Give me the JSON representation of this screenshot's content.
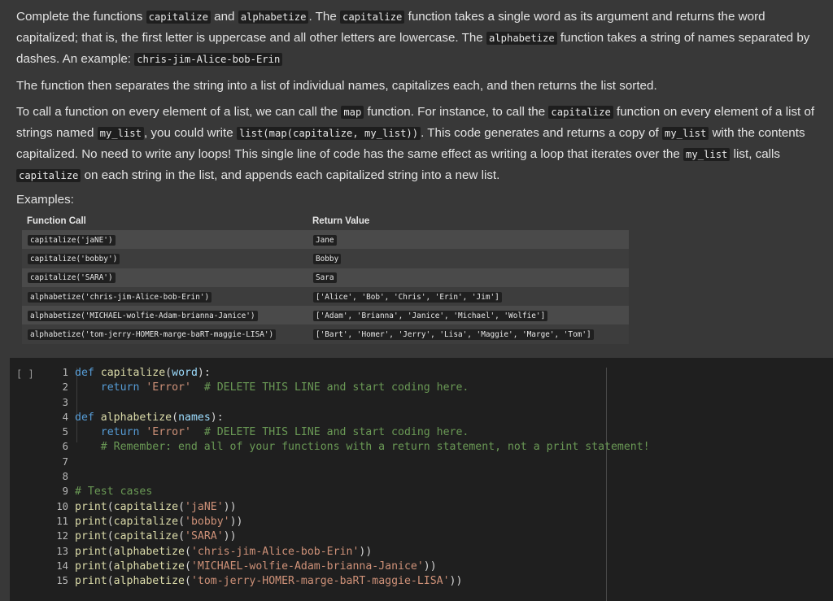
{
  "markdown": {
    "p1": {
      "t1": "Complete the functions ",
      "c1": "capitalize",
      "t2": " and ",
      "c2": "alphabetize",
      "t3": ". The ",
      "c3": "capitalize",
      "t4": " function takes a single word as its argument and returns the word capitalized; that is, the first letter is uppercase and all other letters are lowercase. The ",
      "c4": "alphabetize",
      "t5": " function takes a string of names separated by dashes. An example: ",
      "c5": "chris-jim-Alice-bob-Erin"
    },
    "p2": "The function then separates the string into a list of individual names, capitalizes each, and then returns the list sorted.",
    "p3": {
      "t1": "To call a function on every element of a list, we can call the ",
      "c1": "map",
      "t2": " function. For instance, to call the ",
      "c2": "capitalize",
      "t3": " function on every element of a list of strings named ",
      "c3": "my_list",
      "t4": ", you could write ",
      "c4": "list(map(capitalize, my_list))",
      "t5": ". This code generates and returns a copy of ",
      "c5": "my_list",
      "t6": " with the contents capitalized. No need to write any loops! This single line of code has the same effect as writing a loop that iterates over the ",
      "c6": "my_list",
      "t7": " list, calls ",
      "c7": "capitalize",
      "t8": " on each string in the list, and appends each capitalized string into a new list."
    },
    "examples_label": "Examples:",
    "table": {
      "headers": [
        "Function Call",
        "Return Value"
      ],
      "rows": [
        [
          "capitalize('jaNE')",
          "Jane"
        ],
        [
          "capitalize('bobby')",
          "Bobby"
        ],
        [
          "capitalize('SARA')",
          "Sara"
        ],
        [
          "alphabetize('chris-jim-Alice-bob-Erin')",
          "['Alice', 'Bob', 'Chris', 'Erin', 'Jim']"
        ],
        [
          "alphabetize('MICHAEL-wolfie-Adam-brianna-Janice')",
          "['Adam', 'Brianna', 'Janice', 'Michael', 'Wolfie']"
        ],
        [
          "alphabetize('tom-jerry-HOMER-marge-baRT-maggie-LISA')",
          "['Bart', 'Homer', 'Jerry', 'Lisa', 'Maggie', 'Marge', 'Tom']"
        ]
      ]
    }
  },
  "code_cell": {
    "run_indicator": "[ ]",
    "lines": [
      {
        "n": "1",
        "tokens": [
          [
            "kw",
            "def "
          ],
          [
            "fn",
            "capitalize"
          ],
          [
            "punc",
            "("
          ],
          [
            "par",
            "word"
          ],
          [
            "punc",
            "):"
          ]
        ]
      },
      {
        "n": "2",
        "tokens": [
          [
            "pr",
            "    "
          ],
          [
            "kw",
            "return "
          ],
          [
            "str",
            "'Error'"
          ],
          [
            "pr",
            "  "
          ],
          [
            "cm",
            "# DELETE THIS LINE and start coding here."
          ]
        ]
      },
      {
        "n": "3",
        "tokens": []
      },
      {
        "n": "4",
        "tokens": [
          [
            "kw",
            "def "
          ],
          [
            "fn",
            "alphabetize"
          ],
          [
            "punc",
            "("
          ],
          [
            "par",
            "names"
          ],
          [
            "punc",
            "):"
          ]
        ]
      },
      {
        "n": "5",
        "tokens": [
          [
            "pr",
            "    "
          ],
          [
            "kw",
            "return "
          ],
          [
            "str",
            "'Error'"
          ],
          [
            "pr",
            "  "
          ],
          [
            "cm",
            "# DELETE THIS LINE and start coding here."
          ]
        ]
      },
      {
        "n": "6",
        "tokens": [
          [
            "pr",
            "    "
          ],
          [
            "cm",
            "# Remember: end all of your functions with a return statement, not a print statement!"
          ]
        ]
      },
      {
        "n": "7",
        "tokens": []
      },
      {
        "n": "8",
        "tokens": []
      },
      {
        "n": "9",
        "tokens": [
          [
            "cm",
            "# Test cases"
          ]
        ]
      },
      {
        "n": "10",
        "tokens": [
          [
            "fn",
            "print"
          ],
          [
            "punc",
            "("
          ],
          [
            "fn",
            "capitalize"
          ],
          [
            "punc",
            "("
          ],
          [
            "str",
            "'jaNE'"
          ],
          [
            "punc",
            "))"
          ]
        ]
      },
      {
        "n": "11",
        "tokens": [
          [
            "fn",
            "print"
          ],
          [
            "punc",
            "("
          ],
          [
            "fn",
            "capitalize"
          ],
          [
            "punc",
            "("
          ],
          [
            "str",
            "'bobby'"
          ],
          [
            "punc",
            "))"
          ]
        ]
      },
      {
        "n": "12",
        "tokens": [
          [
            "fn",
            "print"
          ],
          [
            "punc",
            "("
          ],
          [
            "fn",
            "capitalize"
          ],
          [
            "punc",
            "("
          ],
          [
            "str",
            "'SARA'"
          ],
          [
            "punc",
            "))"
          ]
        ]
      },
      {
        "n": "13",
        "tokens": [
          [
            "fn",
            "print"
          ],
          [
            "punc",
            "("
          ],
          [
            "fn",
            "alphabetize"
          ],
          [
            "punc",
            "("
          ],
          [
            "str",
            "'chris-jim-Alice-bob-Erin'"
          ],
          [
            "punc",
            "))"
          ]
        ]
      },
      {
        "n": "14",
        "tokens": [
          [
            "fn",
            "print"
          ],
          [
            "punc",
            "("
          ],
          [
            "fn",
            "alphabetize"
          ],
          [
            "punc",
            "("
          ],
          [
            "str",
            "'MICHAEL-wolfie-Adam-brianna-Janice'"
          ],
          [
            "punc",
            "))"
          ]
        ]
      },
      {
        "n": "15",
        "tokens": [
          [
            "fn",
            "print"
          ],
          [
            "punc",
            "("
          ],
          [
            "fn",
            "alphabetize"
          ],
          [
            "punc",
            "("
          ],
          [
            "str",
            "'tom-jerry-HOMER-marge-baRT-maggie-LISA'"
          ],
          [
            "punc",
            "))"
          ]
        ]
      }
    ]
  }
}
